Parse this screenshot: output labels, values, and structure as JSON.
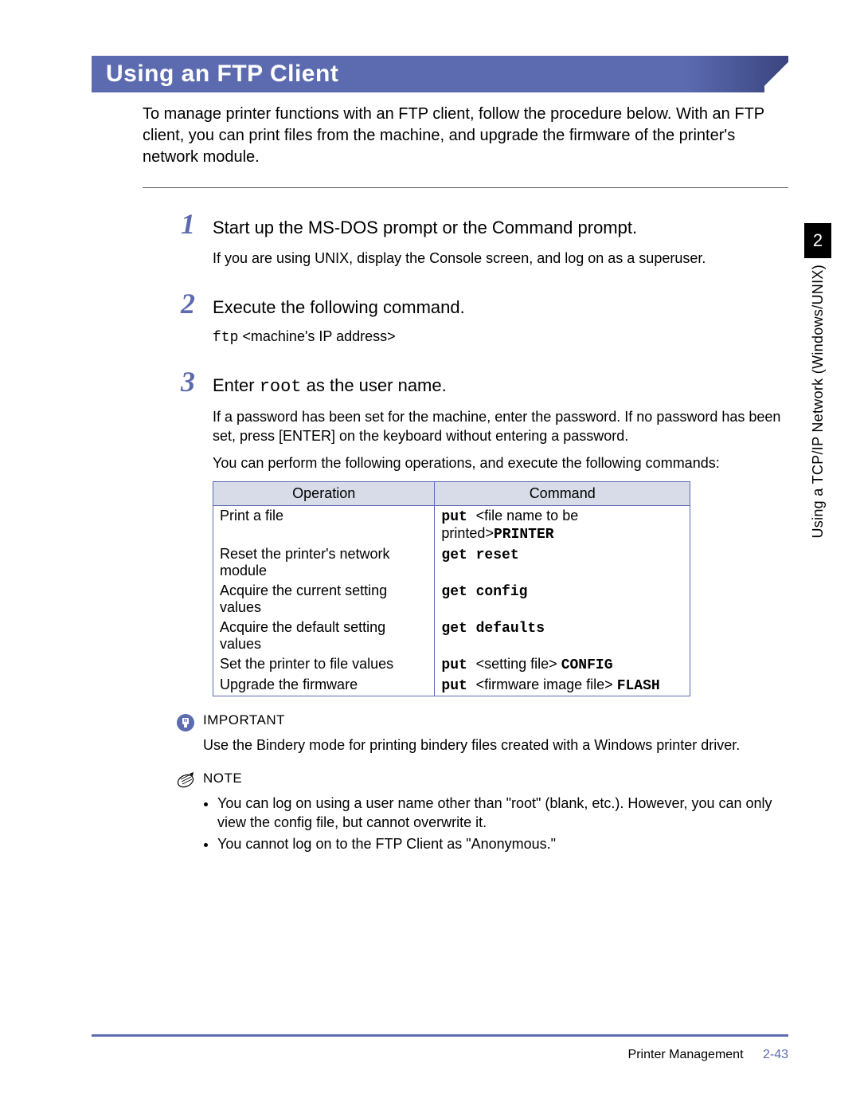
{
  "section": {
    "title": "Using an FTP Client"
  },
  "intro": "To manage printer functions with an FTP client, follow the procedure below. With an FTP client, you can print files from the machine, and upgrade the firmware of the printer's network module.",
  "sidebar": {
    "chapter_num": "2",
    "chapter_title": "Using a TCP/IP Network (Windows/UNIX)"
  },
  "steps": {
    "s1": {
      "num": "1",
      "title": "Start up the MS-DOS prompt or the Command prompt.",
      "sub": "If you are using UNIX, display the Console screen, and log on as a superuser."
    },
    "s2": {
      "num": "2",
      "title": "Execute the following command.",
      "cmd_prefix": "ftp",
      "cmd_arg": " <machine's IP address>"
    },
    "s3": {
      "num": "3",
      "title_a": "Enter ",
      "title_code": "root",
      "title_b": " as the user name.",
      "sub1": "If a password has been set for the machine, enter the password. If no password has been set, press [ENTER] on the keyboard without entering a password.",
      "sub2": "You can perform the following operations, and execute the following commands:"
    }
  },
  "table": {
    "headers": {
      "op": "Operation",
      "cmd": "Command"
    },
    "rows": [
      {
        "op": "Print a file",
        "c1": "put ",
        "c2": "<file name to be printed>",
        "c3": "PRINTER"
      },
      {
        "op": "Reset the printer's network module",
        "c1": "get reset",
        "c2": "",
        "c3": ""
      },
      {
        "op": "Acquire the current setting values",
        "c1": "get config",
        "c2": "",
        "c3": ""
      },
      {
        "op": "Acquire the default setting values",
        "c1": "get defaults",
        "c2": "",
        "c3": ""
      },
      {
        "op": "Set the printer to file values",
        "c1": "put ",
        "c2": "<setting file> ",
        "c3": "CONFIG"
      },
      {
        "op": "Upgrade the firmware",
        "c1": "put ",
        "c2": "<firmware image file> ",
        "c3": "FLASH"
      }
    ]
  },
  "important": {
    "label": "IMPORTANT",
    "text": "Use the Bindery mode for printing bindery files created with a Windows printer driver."
  },
  "note": {
    "label": "NOTE",
    "items": [
      "You can log on using a user name other than \"root\" (blank, etc.). However, you can only view the config file, but cannot overwrite it.",
      "You cannot log on to the FTP Client as \"Anonymous.\""
    ]
  },
  "footer": {
    "section": "Printer Management",
    "page": "2-43"
  }
}
